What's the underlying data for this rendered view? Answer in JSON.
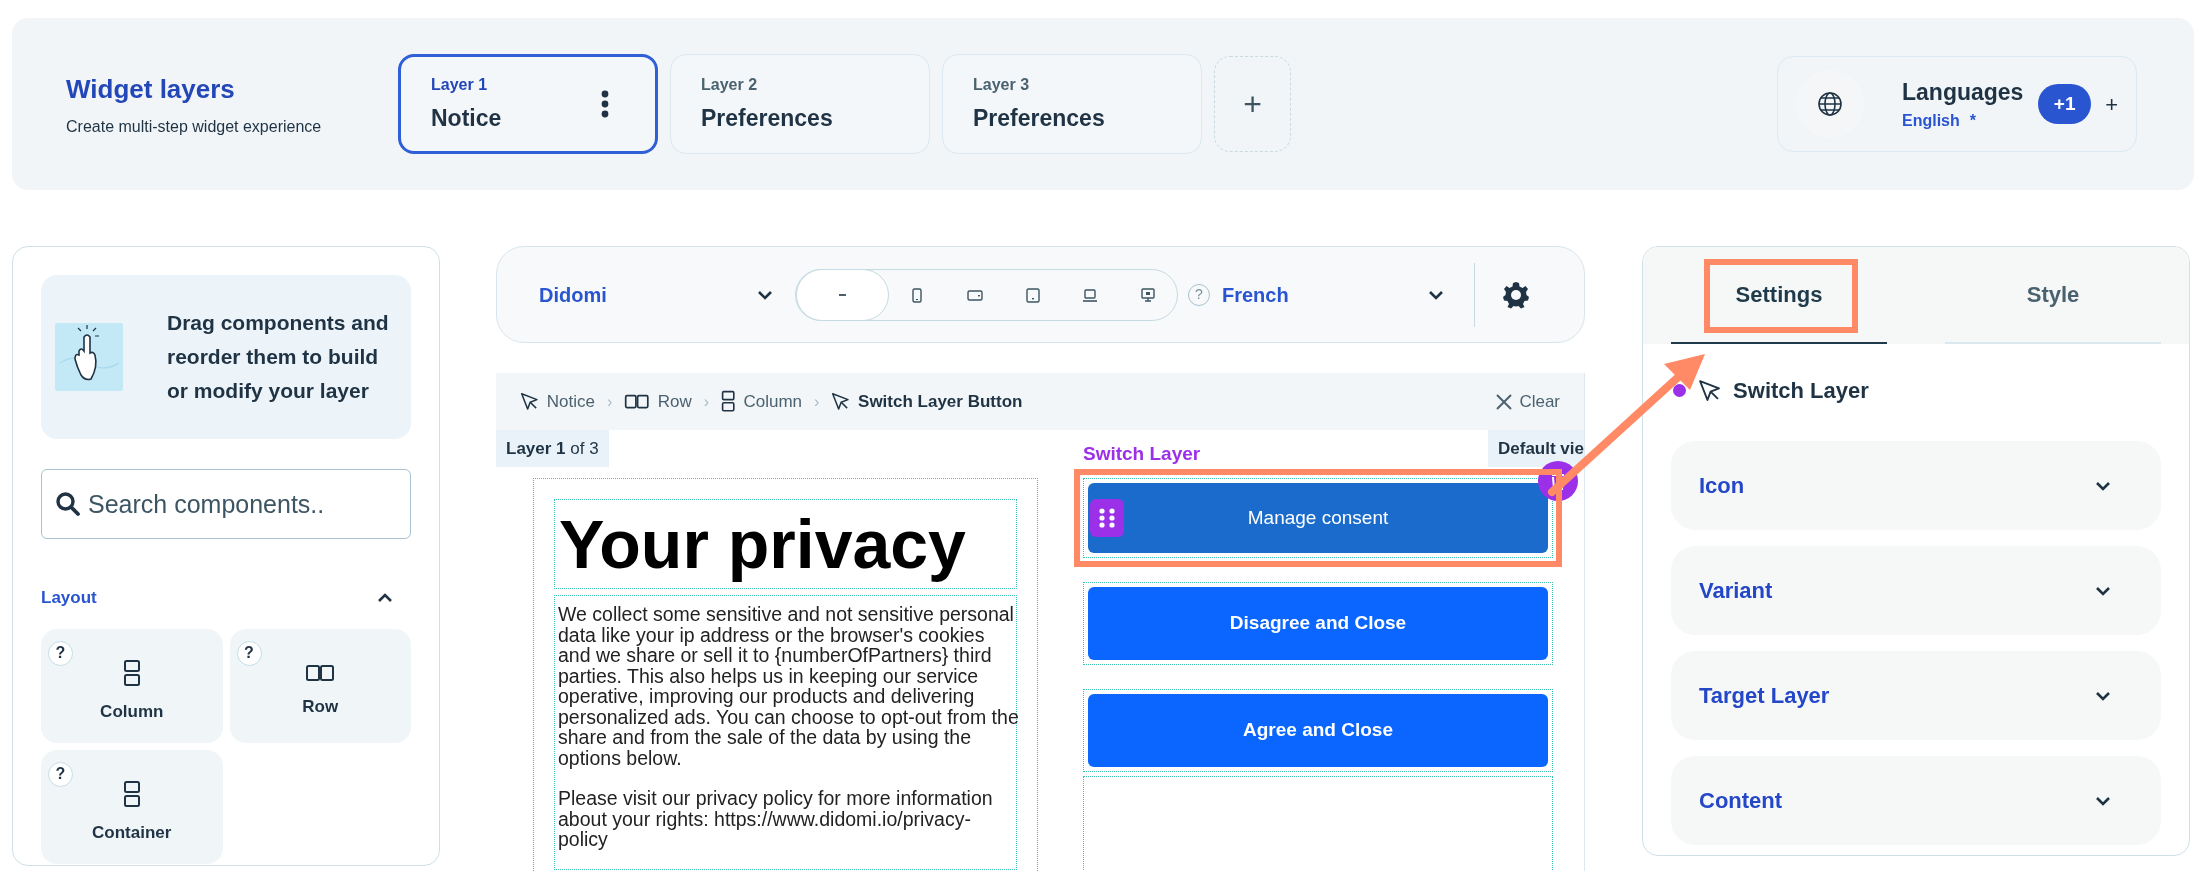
{
  "header": {
    "title": "Widget layers",
    "subtitle": "Create multi-step widget experience"
  },
  "layers": [
    {
      "label": "Layer 1",
      "name": "Notice",
      "selected": true
    },
    {
      "label": "Layer 2",
      "name": "Preferences",
      "selected": false
    },
    {
      "label": "Layer 3",
      "name": "Preferences",
      "selected": false
    }
  ],
  "add_layer": "+",
  "languages": {
    "title": "Languages",
    "default": "English",
    "marker": "*",
    "count": "+1",
    "add": "+"
  },
  "sidebar": {
    "hint": "Drag components and reorder them to build or modify your layer",
    "search": {
      "placeholder": "Search components.."
    },
    "section": {
      "title": "Layout",
      "expanded": true
    },
    "components": [
      {
        "label": "Column",
        "kind": "column",
        "help": "?"
      },
      {
        "label": "Row",
        "kind": "row",
        "help": "?"
      },
      {
        "label": "Container",
        "kind": "column",
        "help": "?"
      }
    ]
  },
  "toolbar": {
    "theme": "Didomi",
    "devices": [
      {
        "kind": "minus",
        "selected": true
      },
      {
        "kind": "phone",
        "selected": false
      },
      {
        "kind": "phone-landscape",
        "selected": false
      },
      {
        "kind": "tablet",
        "selected": false
      },
      {
        "kind": "laptop",
        "selected": false
      },
      {
        "kind": "desktop",
        "selected": false
      }
    ],
    "help": "?",
    "language": "French"
  },
  "breadcrumb": [
    {
      "label": "Notice",
      "kind": "cursor",
      "current": false
    },
    {
      "label": "Row",
      "kind": "row",
      "current": false
    },
    {
      "label": "Column",
      "kind": "column",
      "current": false
    },
    {
      "label": "Switch Layer Button",
      "kind": "cursor",
      "current": true
    }
  ],
  "breadcrumb_separator": "›",
  "clear": "Clear",
  "canvas": {
    "layer_tag": "**Layer 1** of 3",
    "view_tag": "Default vie",
    "heading": "Your privacy",
    "paragraphs": [
      "We collect some sensitive and not sensitive personal data like your ip address or the browser's cookies and we share or sell it to {numberOfPartners} third parties. This also helps us in keeping our service operative, improving our products and delivering personalized ads. You can choose to opt-out from the share and from the sale of the data by using the options below.",
      "Please visit our privacy policy for more information about your rights: https://www.didomi.io/privacy-policy"
    ],
    "selected_label": "Switch Layer",
    "buttons": [
      {
        "label": "Manage consent",
        "selected": true
      },
      {
        "label": "Disagree and Close",
        "selected": false
      },
      {
        "label": "Agree and Close",
        "selected": false
      }
    ]
  },
  "panel": {
    "tabs": [
      {
        "label": "Settings",
        "selected": true
      },
      {
        "label": "Style",
        "selected": false
      }
    ],
    "component": {
      "name": "Switch Layer",
      "color": "#9b30e8"
    },
    "sections": [
      {
        "label": "Icon",
        "expanded": false
      },
      {
        "label": "Variant",
        "expanded": false
      },
      {
        "label": "Target Layer",
        "expanded": false
      },
      {
        "label": "Content",
        "expanded": false
      }
    ]
  }
}
